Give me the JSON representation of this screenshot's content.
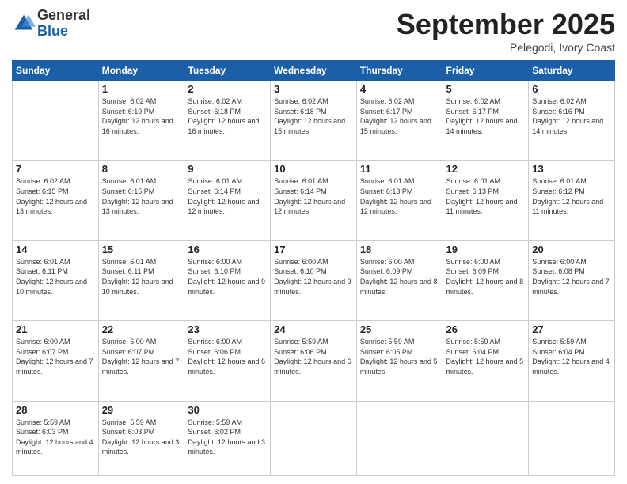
{
  "logo": {
    "general": "General",
    "blue": "Blue"
  },
  "header": {
    "title": "September 2025",
    "subtitle": "Pelegodi, Ivory Coast"
  },
  "weekdays": [
    "Sunday",
    "Monday",
    "Tuesday",
    "Wednesday",
    "Thursday",
    "Friday",
    "Saturday"
  ],
  "weeks": [
    [
      {
        "day": "",
        "info": ""
      },
      {
        "day": "1",
        "info": "Sunrise: 6:02 AM\nSunset: 6:19 PM\nDaylight: 12 hours\nand 16 minutes."
      },
      {
        "day": "2",
        "info": "Sunrise: 6:02 AM\nSunset: 6:18 PM\nDaylight: 12 hours\nand 16 minutes."
      },
      {
        "day": "3",
        "info": "Sunrise: 6:02 AM\nSunset: 6:18 PM\nDaylight: 12 hours\nand 15 minutes."
      },
      {
        "day": "4",
        "info": "Sunrise: 6:02 AM\nSunset: 6:17 PM\nDaylight: 12 hours\nand 15 minutes."
      },
      {
        "day": "5",
        "info": "Sunrise: 6:02 AM\nSunset: 6:17 PM\nDaylight: 12 hours\nand 14 minutes."
      },
      {
        "day": "6",
        "info": "Sunrise: 6:02 AM\nSunset: 6:16 PM\nDaylight: 12 hours\nand 14 minutes."
      }
    ],
    [
      {
        "day": "7",
        "info": "Sunrise: 6:02 AM\nSunset: 6:15 PM\nDaylight: 12 hours\nand 13 minutes."
      },
      {
        "day": "8",
        "info": "Sunrise: 6:01 AM\nSunset: 6:15 PM\nDaylight: 12 hours\nand 13 minutes."
      },
      {
        "day": "9",
        "info": "Sunrise: 6:01 AM\nSunset: 6:14 PM\nDaylight: 12 hours\nand 12 minutes."
      },
      {
        "day": "10",
        "info": "Sunrise: 6:01 AM\nSunset: 6:14 PM\nDaylight: 12 hours\nand 12 minutes."
      },
      {
        "day": "11",
        "info": "Sunrise: 6:01 AM\nSunset: 6:13 PM\nDaylight: 12 hours\nand 12 minutes."
      },
      {
        "day": "12",
        "info": "Sunrise: 6:01 AM\nSunset: 6:13 PM\nDaylight: 12 hours\nand 11 minutes."
      },
      {
        "day": "13",
        "info": "Sunrise: 6:01 AM\nSunset: 6:12 PM\nDaylight: 12 hours\nand 11 minutes."
      }
    ],
    [
      {
        "day": "14",
        "info": "Sunrise: 6:01 AM\nSunset: 6:11 PM\nDaylight: 12 hours\nand 10 minutes."
      },
      {
        "day": "15",
        "info": "Sunrise: 6:01 AM\nSunset: 6:11 PM\nDaylight: 12 hours\nand 10 minutes."
      },
      {
        "day": "16",
        "info": "Sunrise: 6:00 AM\nSunset: 6:10 PM\nDaylight: 12 hours\nand 9 minutes."
      },
      {
        "day": "17",
        "info": "Sunrise: 6:00 AM\nSunset: 6:10 PM\nDaylight: 12 hours\nand 9 minutes."
      },
      {
        "day": "18",
        "info": "Sunrise: 6:00 AM\nSunset: 6:09 PM\nDaylight: 12 hours\nand 8 minutes."
      },
      {
        "day": "19",
        "info": "Sunrise: 6:00 AM\nSunset: 6:09 PM\nDaylight: 12 hours\nand 8 minutes."
      },
      {
        "day": "20",
        "info": "Sunrise: 6:00 AM\nSunset: 6:08 PM\nDaylight: 12 hours\nand 7 minutes."
      }
    ],
    [
      {
        "day": "21",
        "info": "Sunrise: 6:00 AM\nSunset: 6:07 PM\nDaylight: 12 hours\nand 7 minutes."
      },
      {
        "day": "22",
        "info": "Sunrise: 6:00 AM\nSunset: 6:07 PM\nDaylight: 12 hours\nand 7 minutes."
      },
      {
        "day": "23",
        "info": "Sunrise: 6:00 AM\nSunset: 6:06 PM\nDaylight: 12 hours\nand 6 minutes."
      },
      {
        "day": "24",
        "info": "Sunrise: 5:59 AM\nSunset: 6:06 PM\nDaylight: 12 hours\nand 6 minutes."
      },
      {
        "day": "25",
        "info": "Sunrise: 5:59 AM\nSunset: 6:05 PM\nDaylight: 12 hours\nand 5 minutes."
      },
      {
        "day": "26",
        "info": "Sunrise: 5:59 AM\nSunset: 6:04 PM\nDaylight: 12 hours\nand 5 minutes."
      },
      {
        "day": "27",
        "info": "Sunrise: 5:59 AM\nSunset: 6:04 PM\nDaylight: 12 hours\nand 4 minutes."
      }
    ],
    [
      {
        "day": "28",
        "info": "Sunrise: 5:59 AM\nSunset: 6:03 PM\nDaylight: 12 hours\nand 4 minutes."
      },
      {
        "day": "29",
        "info": "Sunrise: 5:59 AM\nSunset: 6:03 PM\nDaylight: 12 hours\nand 3 minutes."
      },
      {
        "day": "30",
        "info": "Sunrise: 5:59 AM\nSunset: 6:02 PM\nDaylight: 12 hours\nand 3 minutes."
      },
      {
        "day": "",
        "info": ""
      },
      {
        "day": "",
        "info": ""
      },
      {
        "day": "",
        "info": ""
      },
      {
        "day": "",
        "info": ""
      }
    ]
  ]
}
